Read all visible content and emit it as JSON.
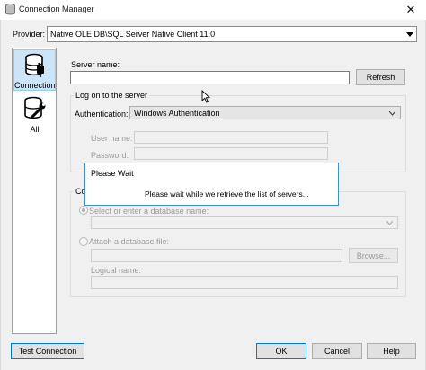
{
  "window": {
    "title": "Connection Manager",
    "close_glyph": "✕"
  },
  "provider": {
    "label": "Provider:",
    "value": "Native OLE DB\\SQL Server Native Client 11.0"
  },
  "sidebar": {
    "items": [
      {
        "label": "Connection",
        "icon": "database-plug-icon",
        "selected": true
      },
      {
        "label": "All",
        "icon": "database-wrench-icon",
        "selected": false
      }
    ]
  },
  "server": {
    "label": "Server name:",
    "value": "",
    "refresh_label": "Refresh"
  },
  "logon": {
    "group_title": "Log on to the server",
    "auth_label": "Authentication:",
    "auth_value": "Windows Authentication",
    "user_label": "User name:",
    "password_label": "Password:"
  },
  "database": {
    "group_title_visible": "Co",
    "select_label": "Select or enter a database name:",
    "attach_label": "Attach a database file:",
    "browse_label": "Browse...",
    "logical_label": "Logical name:"
  },
  "dialog": {
    "title": "Please Wait",
    "message": "Please wait while we retrieve the list of servers..."
  },
  "footer": {
    "test_label": "Test Connection",
    "ok_label": "OK",
    "cancel_label": "Cancel",
    "help_label": "Help"
  },
  "colors": {
    "accent": "#0078d7",
    "selection": "#cce4f7",
    "dialog_border": "#3a8fd6"
  }
}
